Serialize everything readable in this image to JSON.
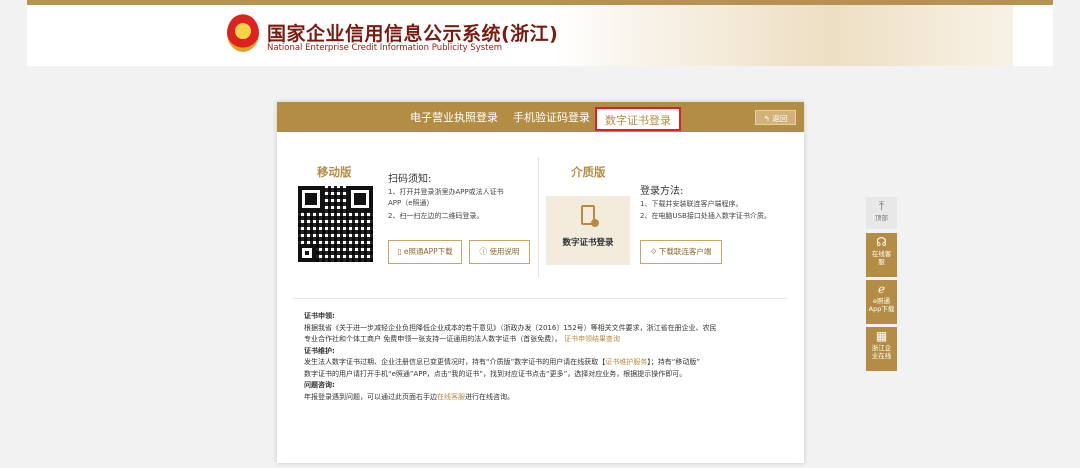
{
  "header": {
    "title": "国家企业信用信息公示系统(浙江)",
    "subtitle": "National Enterprise Credit Information Publicity System"
  },
  "tabs": [
    {
      "label": "电子营业执照登录",
      "active": false
    },
    {
      "label": "手机验证码登录",
      "active": false
    },
    {
      "label": "数字证书登录",
      "active": true
    }
  ],
  "back_label": "返回",
  "mobile": {
    "title": "移动版",
    "scan_heading": "扫码须知:",
    "step1": "1、打开并登录浙里办APP或法人证书",
    "step1b": "APP（e照通）",
    "step2": "2、扫一扫左边的二维码登录。",
    "download_button": "e照通APP下载",
    "help_button": "使用说明"
  },
  "media": {
    "title": "介质版",
    "box_label": "数字证书登录",
    "method_heading": "登录方法:",
    "step1": "1、下载并安装联连客户端程序。",
    "step2": "2、在电脑USB接口处插入数字证书介质。",
    "download_button": "下载联连客户端"
  },
  "notes": {
    "apply_heading": "证书申领:",
    "apply_text": "根据我省《关于进一步减轻企业负担降低企业成本的若干意见》（浙政办发〔2016〕152号）等相关文件要求，浙江省在册企业、农民",
    "apply_text2": "专业合作社和个体工商户 免费申领一张支持一证通用的法人数字证书（首张免费）。",
    "apply_link": "证书申领结果查询",
    "maintain_heading": "证书维护:",
    "maintain_text": "发生法人数字证书过期、企业注册信息已变更情况时，持有“介质版”数字证书的用户请在线获取【",
    "maintain_link": "证书维护服务",
    "maintain_text2": "】；持有“移动版”",
    "maintain_text3": "数字证书的用户请打开手机“e照通”APP，点击“我的证书”，找到对应证书点击“更多”，选择对应业务，根据提示操作即可。",
    "consult_heading": "问题咨询:",
    "consult_text": "年报登录遇到问题，可以通过此页面右手边",
    "consult_link": "在线客服",
    "consult_text2": "进行在线咨询。"
  },
  "sidebar": {
    "top_label": "顶部",
    "service_label": "在线客服",
    "app_label": "e照通App下载",
    "zj_label": "浙江企业在线"
  }
}
